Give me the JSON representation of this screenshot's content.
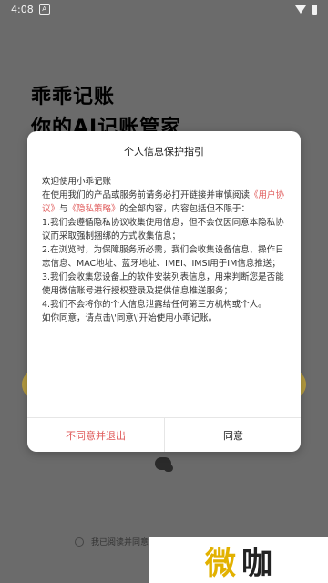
{
  "statusbar": {
    "time": "4:08",
    "notification_icon": "A"
  },
  "app": {
    "title": "乖乖记账",
    "subtitle": "你的AI记账管家"
  },
  "agreement_row": {
    "text": "我已阅读并同意"
  },
  "watermark": {
    "part1": "微",
    "part2": "咖"
  },
  "dialog": {
    "title": "个人信息保护指引",
    "body": {
      "welcome": "欢迎使用小乖记账",
      "intro_prefix": "在使用我们的产品或服务前请务必打开链接并审慎阅读",
      "user_agreement_link": "《用户协议》",
      "and": "与",
      "privacy_link": "《隐私策略》",
      "intro_suffix": "的全部内容，内容包括但不限于：",
      "p1": "1.我们会遵循隐私协议收集使用信息，但不会仅因同意本隐私协议而采取强制捆绑的方式收集信息；",
      "p2": "2.在浏览时，为保障服务所必需，我们会收集设备信息、操作日志信息、MAC地址、蓝牙地址、IMEI、IMSI用于IM信息推送；",
      "p3": "3.我们会收集您设备上的软件安装列表信息，用来判断您是否能使用微信账号进行授权登录及提供信息推送服务；",
      "p4": "4.我们不会将你的个人信息泄露给任何第三方机构或个人。",
      "closing": "如你同意，请点击\\'同意\\'开始使用小乖记账。"
    },
    "buttons": {
      "disagree": "不同意并退出",
      "agree": "同意"
    }
  },
  "colors": {
    "link": "#e05b5b",
    "overlay": "#6b6b6b",
    "accent_pill": "#b39a3f"
  },
  "icons": {
    "wechat": "wechat-icon",
    "wifi": "wifi-icon",
    "battery": "battery-icon"
  }
}
